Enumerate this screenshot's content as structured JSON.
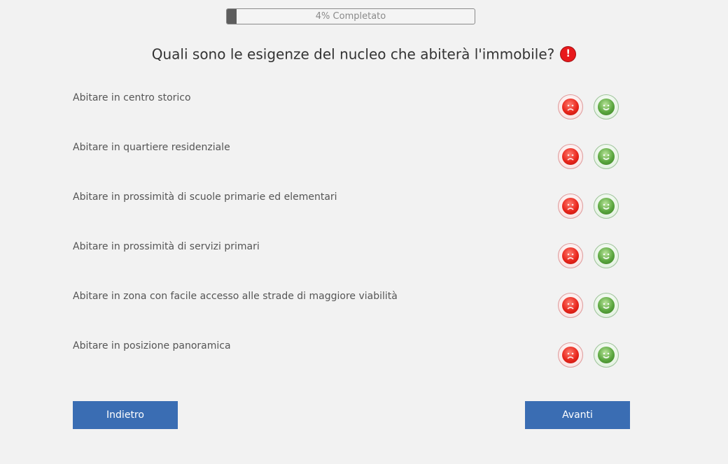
{
  "progress": {
    "percent": 4,
    "label": "4% Completato"
  },
  "question": {
    "title": "Quali sono le esigenze del nucleo che abiterà l'immobile?",
    "help_badge": "!"
  },
  "options": [
    {
      "label": "Abitare in centro storico"
    },
    {
      "label": "Abitare in quartiere residenziale"
    },
    {
      "label": "Abitare in prossimità di scuole primarie ed elementari"
    },
    {
      "label": "Abitare in prossimità di servizi primari"
    },
    {
      "label": "Abitare in zona con facile accesso alle strade di maggiore viabilità"
    },
    {
      "label": "Abitare in posizione panoramica"
    }
  ],
  "icons": {
    "no": "sad-face-icon",
    "yes": "happy-face-icon"
  },
  "colors": {
    "accent": "#3a6db3",
    "no": "#e8261c",
    "yes": "#5aa63e",
    "badge": "#e8191c"
  },
  "nav": {
    "back_label": "Indietro",
    "next_label": "Avanti"
  }
}
